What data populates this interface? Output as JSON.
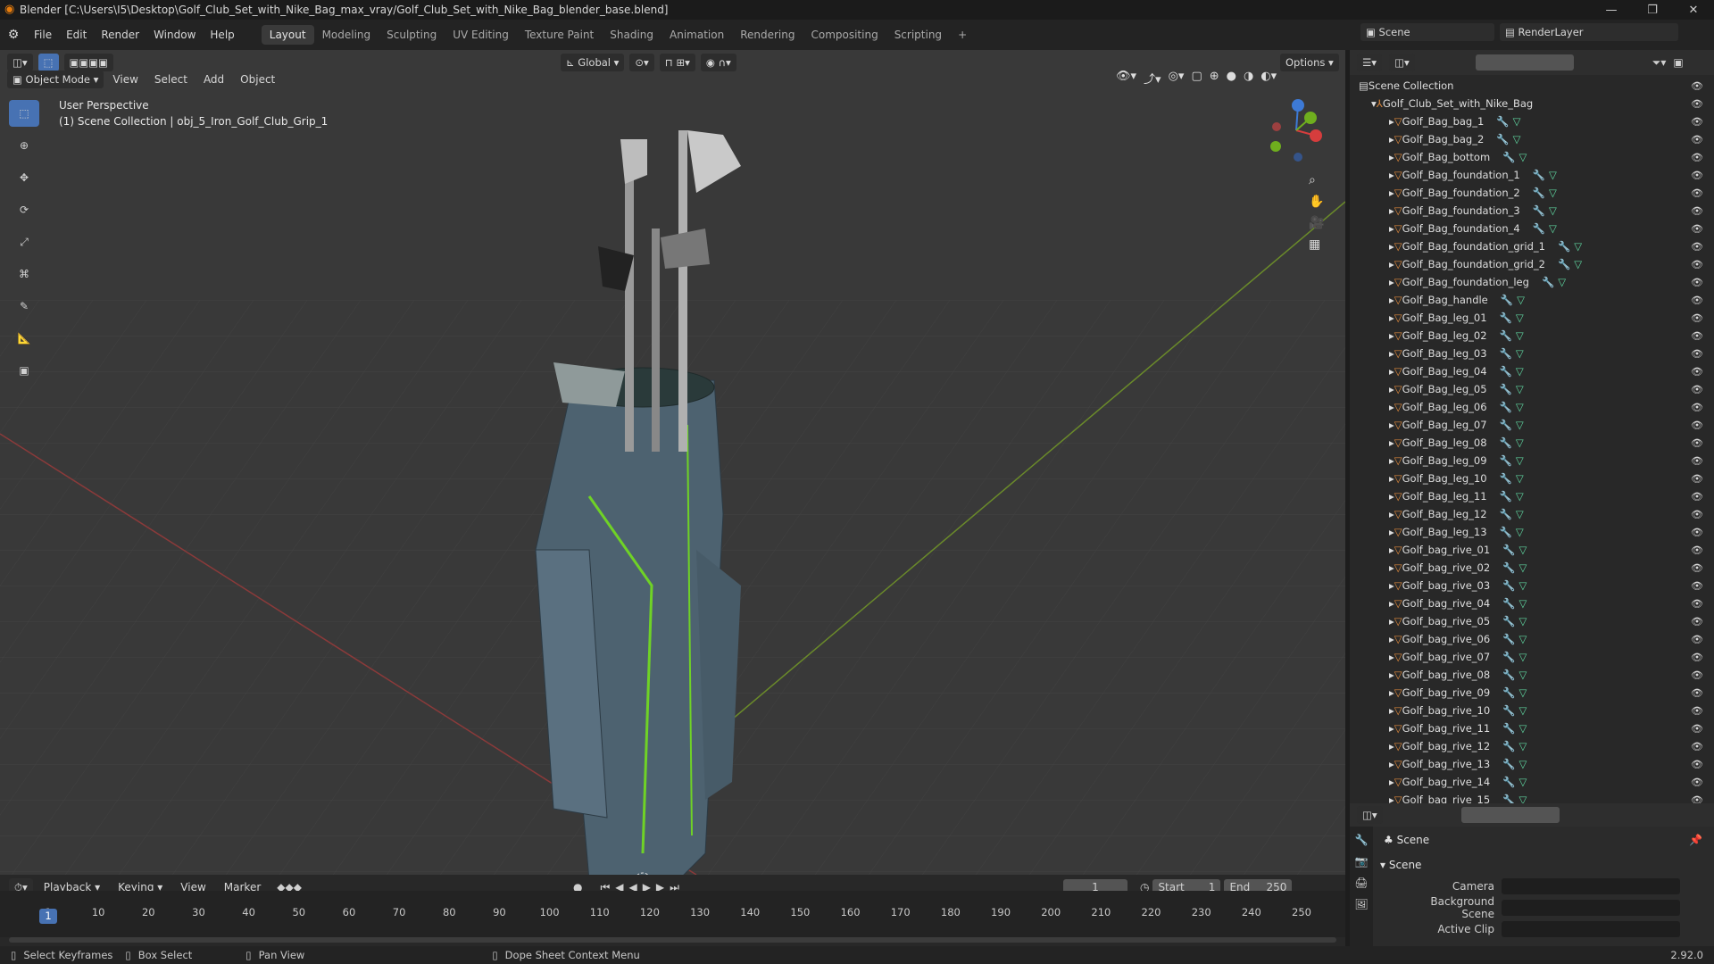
{
  "titlebar": {
    "title": "Blender [C:\\Users\\I5\\Desktop\\Golf_Club_Set_with_Nike_Bag_max_vray/Golf_Club_Set_with_Nike_Bag_blender_base.blend]"
  },
  "menu": [
    "File",
    "Edit",
    "Render",
    "Window",
    "Help"
  ],
  "workspaces": [
    "Layout",
    "Modeling",
    "Sculpting",
    "UV Editing",
    "Texture Paint",
    "Shading",
    "Animation",
    "Rendering",
    "Compositing",
    "Scripting"
  ],
  "scene": {
    "label": "Scene",
    "renderlayer": "RenderLayer"
  },
  "toolbar": {
    "transform_orientation": "Global",
    "options": "Options"
  },
  "viewport_header": {
    "mode": "Object Mode",
    "menus": [
      "View",
      "Select",
      "Add",
      "Object"
    ]
  },
  "viewport_info": {
    "line1": "User Perspective",
    "line2": "(1) Scene Collection | obj_5_Iron_Golf_Club_Grip_1"
  },
  "outliner": {
    "root": "Scene Collection",
    "collection": "Golf_Club_Set_with_Nike_Bag",
    "items": [
      "Golf_Bag_bag_1",
      "Golf_Bag_bag_2",
      "Golf_Bag_bottom",
      "Golf_Bag_foundation_1",
      "Golf_Bag_foundation_2",
      "Golf_Bag_foundation_3",
      "Golf_Bag_foundation_4",
      "Golf_Bag_foundation_grid_1",
      "Golf_Bag_foundation_grid_2",
      "Golf_Bag_foundation_leg",
      "Golf_Bag_handle",
      "Golf_Bag_leg_01",
      "Golf_Bag_leg_02",
      "Golf_Bag_leg_03",
      "Golf_Bag_leg_04",
      "Golf_Bag_leg_05",
      "Golf_Bag_leg_06",
      "Golf_Bag_leg_07",
      "Golf_Bag_leg_08",
      "Golf_Bag_leg_09",
      "Golf_Bag_leg_10",
      "Golf_Bag_leg_11",
      "Golf_Bag_leg_12",
      "Golf_Bag_leg_13",
      "Golf_bag_rive_01",
      "Golf_bag_rive_02",
      "Golf_bag_rive_03",
      "Golf_bag_rive_04",
      "Golf_bag_rive_05",
      "Golf_bag_rive_06",
      "Golf_bag_rive_07",
      "Golf_bag_rive_08",
      "Golf_bag_rive_09",
      "Golf_bag_rive_10",
      "Golf_bag_rive_11",
      "Golf_bag_rive_12",
      "Golf_bag_rive_13",
      "Golf_bag_rive_14",
      "Golf_bag_rive_15"
    ]
  },
  "properties": {
    "scene_title": "Scene",
    "panel": "Scene",
    "camera_label": "Camera",
    "background_label": "Background Scene",
    "clip_label": "Active Clip"
  },
  "timeline": {
    "menus": [
      "Playback",
      "Keying",
      "View",
      "Marker"
    ],
    "current_frame": "1",
    "start_label": "Start",
    "start": "1",
    "end_label": "End",
    "end": "250",
    "ticks": [
      "1",
      "10",
      "20",
      "30",
      "40",
      "50",
      "60",
      "70",
      "80",
      "90",
      "100",
      "110",
      "120",
      "130",
      "140",
      "150",
      "160",
      "170",
      "180",
      "190",
      "200",
      "210",
      "220",
      "230",
      "240",
      "250"
    ]
  },
  "statusbar": {
    "select": "Select Keyframes",
    "box": "Box Select",
    "pan": "Pan View",
    "context": "Dope Sheet Context Menu",
    "version": "2.92.0"
  },
  "colors": {
    "accent": "#4772b3",
    "object_orange": "#e08a3c",
    "mesh_green": "#5fd6a0"
  }
}
